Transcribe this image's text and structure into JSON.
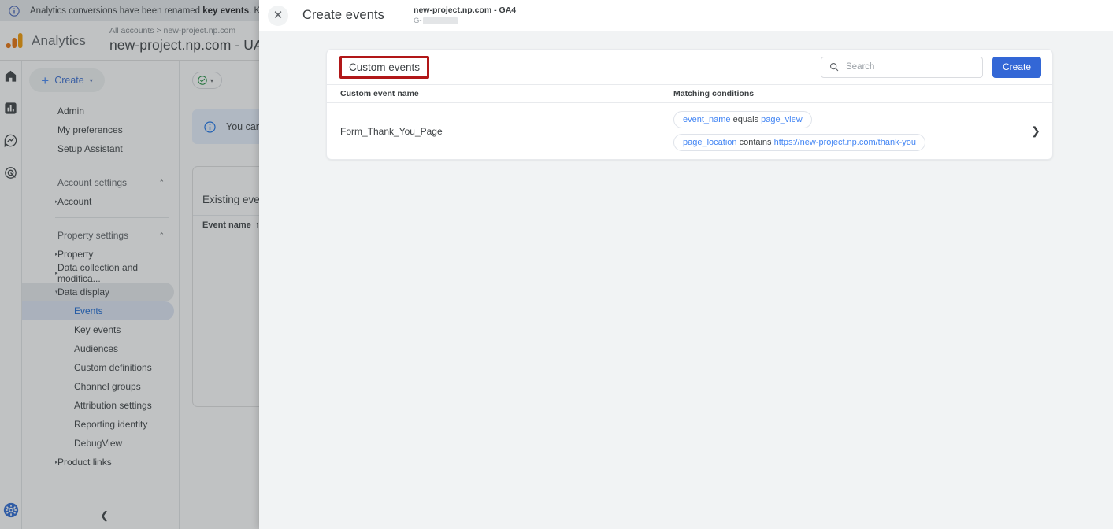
{
  "banner": {
    "icon": "info-icon",
    "text_plain": "Analytics conversions have been renamed ",
    "text_bold": "key events",
    "text_tail": ". Key events m"
  },
  "header": {
    "logo_word": "Analytics",
    "breadcrumb": "All accounts > new-project.np.com",
    "property_title": "new-project.np.com - UA",
    "property_caret": "▾"
  },
  "rail": {
    "icons": [
      "home-icon",
      "reports-icon",
      "explore-icon",
      "advertising-icon"
    ],
    "bottom_icon": "admin-gear-icon"
  },
  "sidebar": {
    "create_button": {
      "plus": "+",
      "label": "Create",
      "caret": "▾"
    },
    "items": [
      {
        "label": "Admin",
        "type": "item",
        "selected": false
      },
      {
        "label": "My preferences",
        "type": "item",
        "selected": false
      },
      {
        "label": "Setup Assistant",
        "type": "item",
        "selected": false
      }
    ],
    "sections": [
      {
        "title": "Account settings",
        "chevron": "⌃",
        "items": [
          {
            "label": "Account",
            "arrow": "▸",
            "selected": false
          }
        ]
      },
      {
        "title": "Property settings",
        "chevron": "⌃",
        "items": [
          {
            "label": "Property",
            "arrow": "▸",
            "selected": false
          },
          {
            "label": "Data collection and modifica...",
            "arrow": "▸",
            "selected": false
          },
          {
            "label": "Data display",
            "arrow": "▾",
            "selected": false,
            "expanded": true
          },
          {
            "label": "Events",
            "sub": true,
            "selected": true
          },
          {
            "label": "Key events",
            "sub": true,
            "selected": false
          },
          {
            "label": "Audiences",
            "sub": true,
            "selected": false
          },
          {
            "label": "Custom definitions",
            "sub": true,
            "selected": false
          },
          {
            "label": "Channel groups",
            "sub": true,
            "selected": false
          },
          {
            "label": "Attribution settings",
            "sub": true,
            "selected": false
          },
          {
            "label": "Reporting identity",
            "sub": true,
            "selected": false
          },
          {
            "label": "DebugView",
            "sub": true,
            "selected": false
          },
          {
            "label": "Product links",
            "arrow": "▸",
            "selected": false
          }
        ]
      }
    ],
    "collapse_chevron": "❮"
  },
  "background_main": {
    "info_text": "You can",
    "card_title": "Existing events",
    "card_column_header": "Event name",
    "card_sort_arrow": "↑"
  },
  "modal": {
    "close_icon": "close-icon",
    "close_glyph": "✕",
    "title": "Create events",
    "property_name": "new-project.np.com - GA4",
    "property_id_prefix": "G-",
    "property_id_redacted": true
  },
  "panel": {
    "title": "Custom events",
    "title_highlight_color": "#b11718",
    "search": {
      "icon": "search-icon",
      "placeholder": "Search",
      "value": ""
    },
    "create_button_label": "Create",
    "create_button_color": "#3367d6",
    "columns": [
      "Custom event name",
      "Matching conditions"
    ],
    "rows": [
      {
        "name": "Form_Thank_You_Page",
        "conditions": [
          {
            "key": "event_name",
            "operator": "equals",
            "value": "page_view"
          },
          {
            "key": "page_location",
            "operator": "contains",
            "value": "https://new-project.np.com/thank-you"
          }
        ],
        "chevron": "❯"
      }
    ]
  }
}
